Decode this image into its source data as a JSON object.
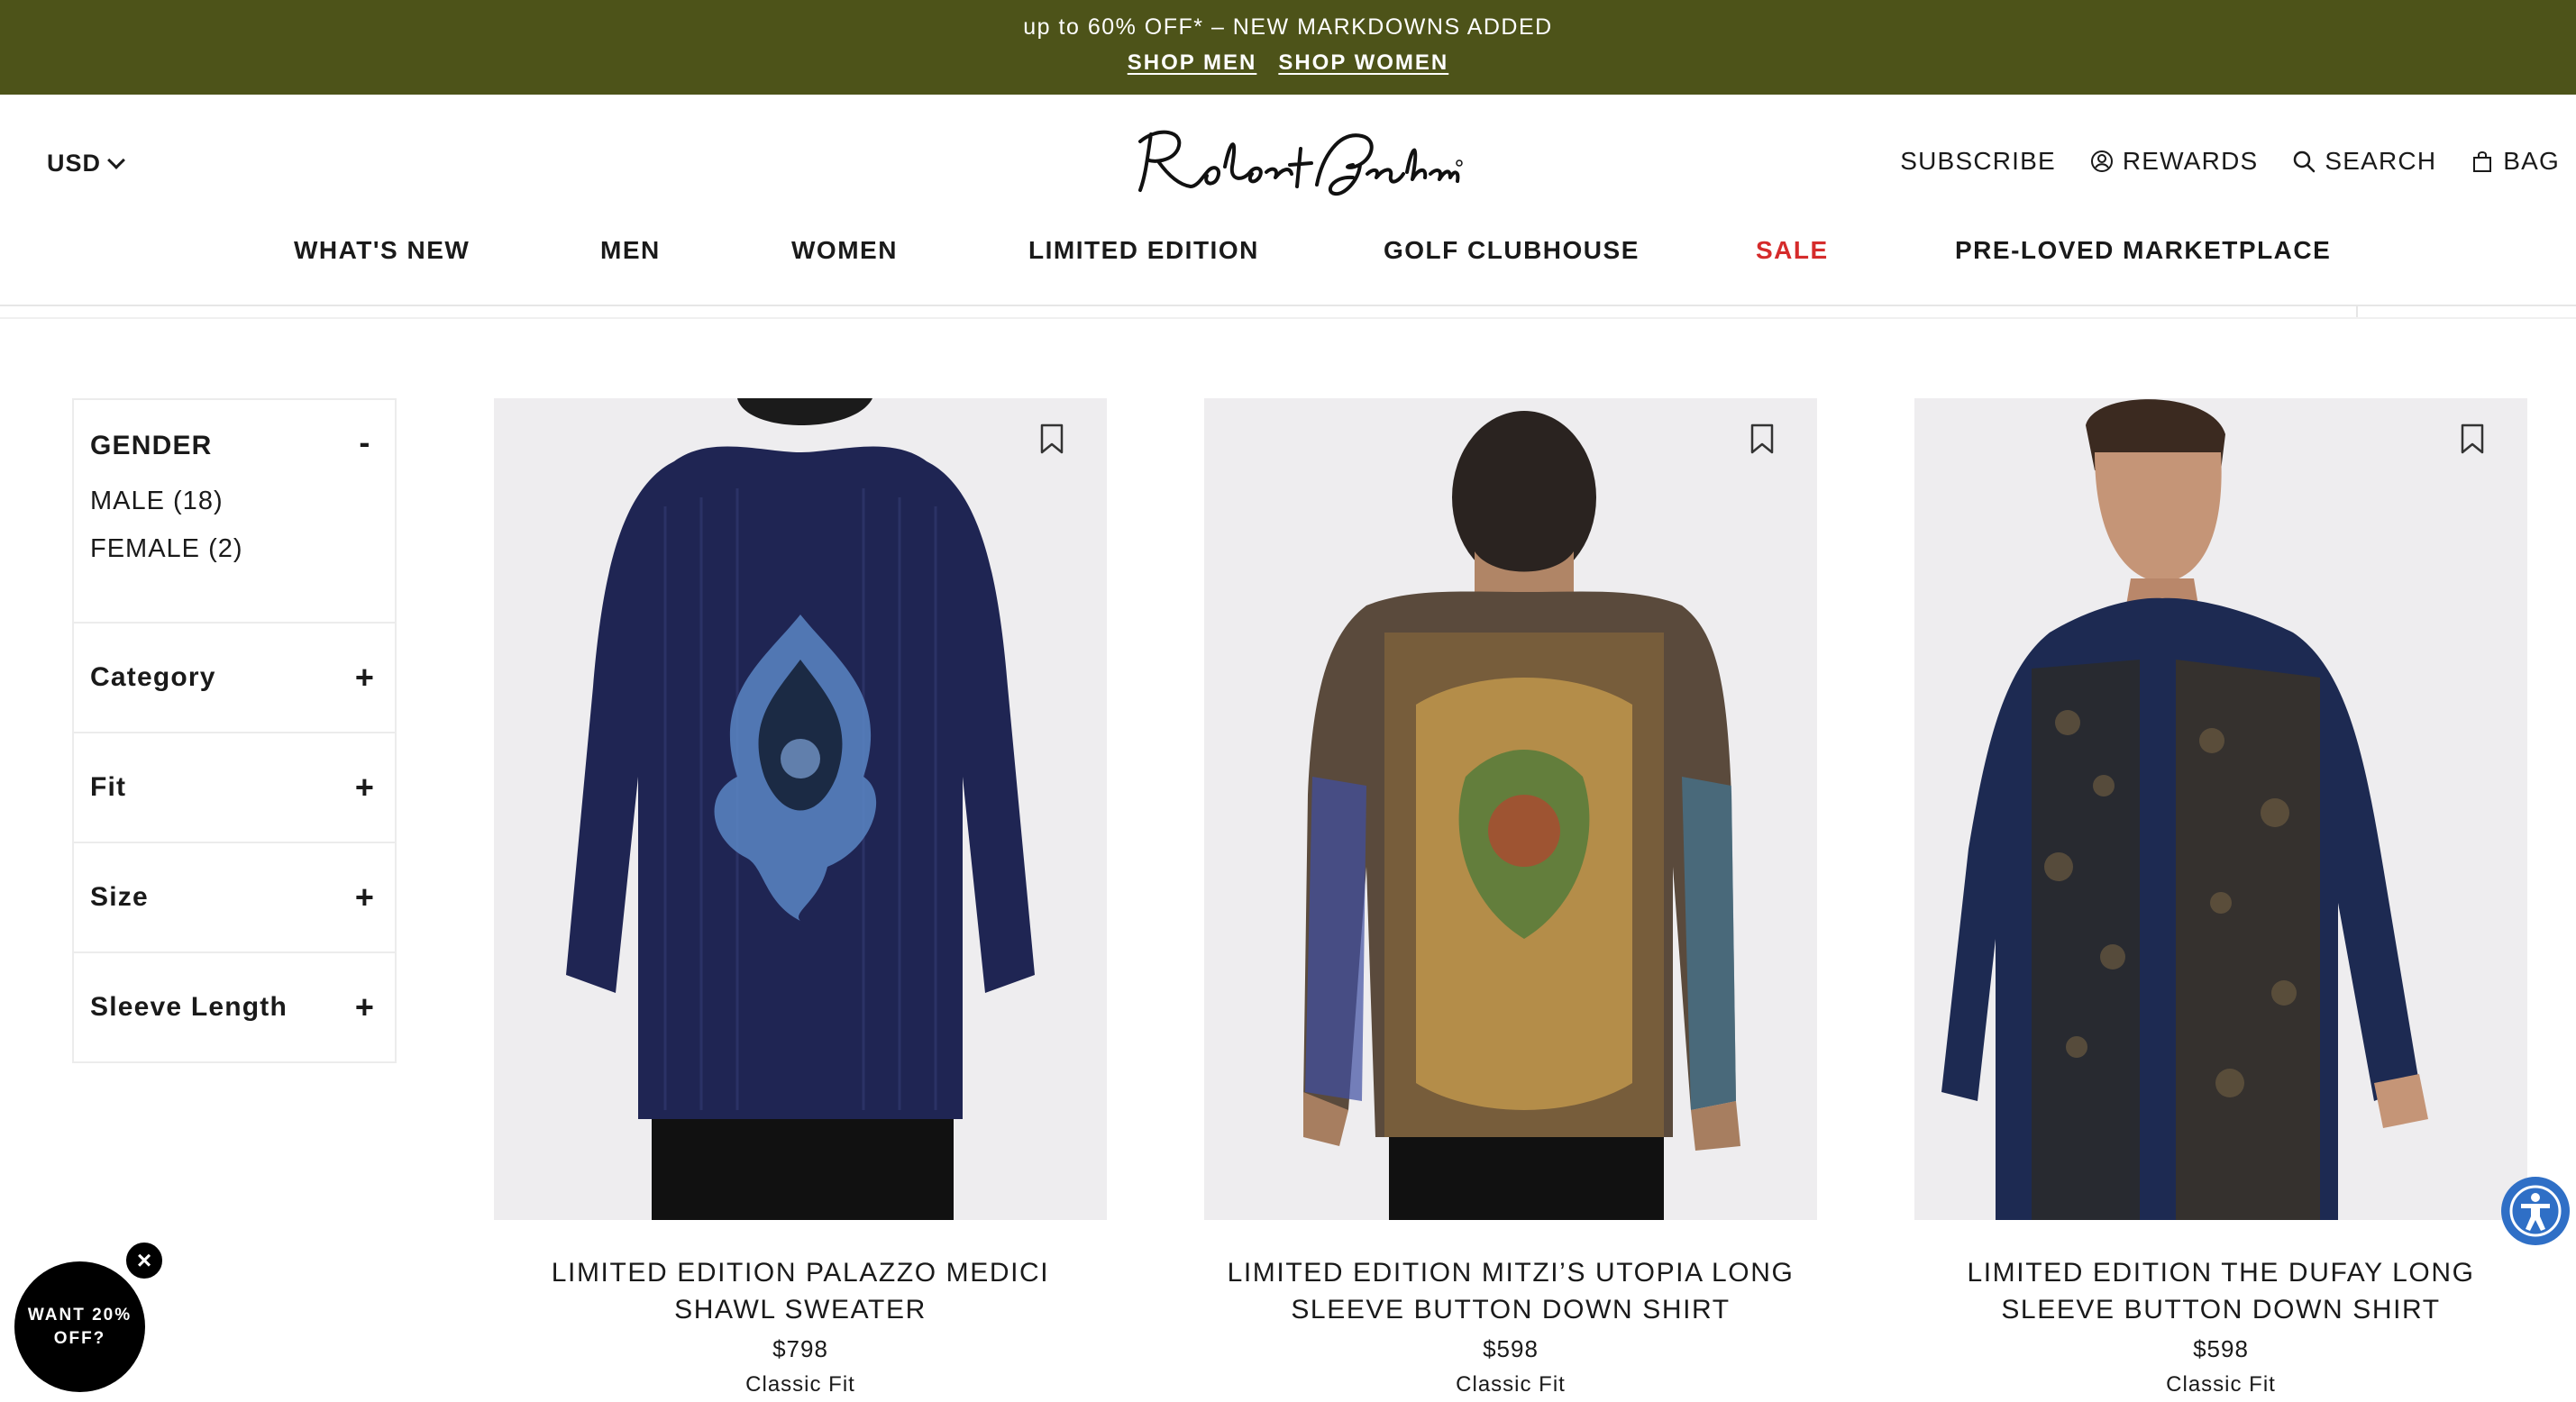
{
  "promo": {
    "text": "up to 60% OFF* – NEW MARKDOWNS ADDED",
    "link_men": "SHOP MEN",
    "link_women": "SHOP WOMEN"
  },
  "header": {
    "currency": "USD",
    "logo_text": "Robert Graham",
    "utility": {
      "subscribe": "SUBSCRIBE",
      "rewards": "REWARDS",
      "search": "SEARCH",
      "bag": "BAG"
    }
  },
  "nav": {
    "items": [
      "WHAT'S NEW",
      "MEN",
      "WOMEN",
      "LIMITED EDITION",
      "GOLF CLUBHOUSE",
      "SALE",
      "PRE-LOVED MARKETPLACE"
    ],
    "accent_color": "#d52b2b"
  },
  "filters": {
    "gender": {
      "title": "GENDER",
      "toggle": "-",
      "options": [
        "MALE (18)",
        "FEMALE (2)"
      ]
    },
    "category": {
      "title": "Category",
      "toggle": "+"
    },
    "fit": {
      "title": "Fit",
      "toggle": "+"
    },
    "size": {
      "title": "Size",
      "toggle": "+"
    },
    "sleeve": {
      "title": "Sleeve Length",
      "toggle": "+"
    }
  },
  "products": [
    {
      "title": "LIMITED EDITION PALAZZO MEDICI SHAWL SWEATER",
      "price": "$798",
      "fit": "Classic Fit"
    },
    {
      "title": "LIMITED EDITION MITZI’S UTOPIA LONG SLEEVE BUTTON DOWN SHIRT",
      "price": "$598",
      "fit": "Classic Fit"
    },
    {
      "title": "LIMITED EDITION THE DUFAY LONG SLEEVE BUTTON DOWN SHIRT",
      "price": "$598",
      "fit": "Classic Fit"
    }
  ],
  "popup": {
    "discount": "WANT 20% OFF?",
    "close": "×"
  },
  "colors": {
    "promo_bg": "#4d5319",
    "accessibility": "#2f6fc6"
  }
}
